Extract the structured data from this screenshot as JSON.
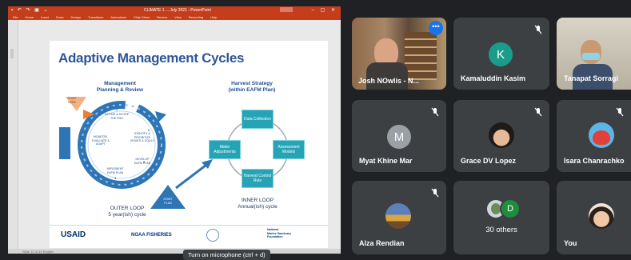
{
  "presentation": {
    "window_title": "CLIMATE 1 ... July 2021 - PowerPoint",
    "menu_items": [
      "File",
      "Home",
      "Insert",
      "Draw",
      "Design",
      "Transitions",
      "Animations",
      "Slide Show",
      "Review",
      "View",
      "Recording",
      "Help"
    ],
    "status_text": "Slide 12 of 43  English",
    "slide": {
      "title": "Adaptive Management Cycles",
      "left_heading": "Management\nPlanning & Review",
      "outer_loop": "OUTER LOOP\n5 year(ish) cycle",
      "harvest_heading": "Harvest Strategy\n(within EAFM Plan)",
      "boxes": [
        "Data\nCollection",
        "Assessment\nModels",
        "Harvest\nControl Rule",
        "Make\nAdjustments"
      ],
      "inner_loop": "INNER LOOP\nAnnual(ish) cycle",
      "start_here": "START\nHERE",
      "start_plan": "START\nPLAN",
      "cycle_steps": [
        "DEFINE & SCOPE\nTHE FMU",
        "IDENTIFY &\nPRIORITIZE\nISSUES & GOALS",
        "DEVELOP\nEAFM PLAN",
        "IMPLEMENT\nEAFM PLAN",
        "MONITOR,\nEVALUATE &\nADAPT"
      ],
      "cycle_numbers": [
        "1",
        "2",
        "3",
        "4",
        "5"
      ],
      "logos": [
        "USAID",
        "NOAA FISHERIES",
        "National\nMarine Sanctuary\nFoundation"
      ]
    }
  },
  "tooltip": "Turn on microphone (ctrl + d)",
  "participants": [
    {
      "name": "Josh NOwlis - N...",
      "muted": false,
      "type": "video"
    },
    {
      "name": "Kamaluddin Kasim",
      "muted": true,
      "initial": "K",
      "color": "#1a9c8a"
    },
    {
      "name": "Tanapat Sorragi",
      "muted": false,
      "type": "video"
    },
    {
      "name": "Myat Khine Mar",
      "muted": true,
      "initial": "M",
      "color": "#9aa0a6"
    },
    {
      "name": "Grace DV Lopez",
      "muted": true,
      "type": "photo"
    },
    {
      "name": "Isara Chanrachko",
      "muted": true,
      "type": "photo"
    },
    {
      "name": "Alza Rendian",
      "muted": true,
      "type": "photo"
    },
    {
      "name": "30 others",
      "muted": false,
      "type": "group",
      "initial": "D"
    },
    {
      "name": "You",
      "muted": false,
      "type": "photo"
    }
  ],
  "colors": {
    "meet_bg": "#202124",
    "tile_bg": "#3c4043",
    "ppt_red": "#c43e1c",
    "slide_blue": "#2f5597",
    "teal": "#27a3b6"
  }
}
